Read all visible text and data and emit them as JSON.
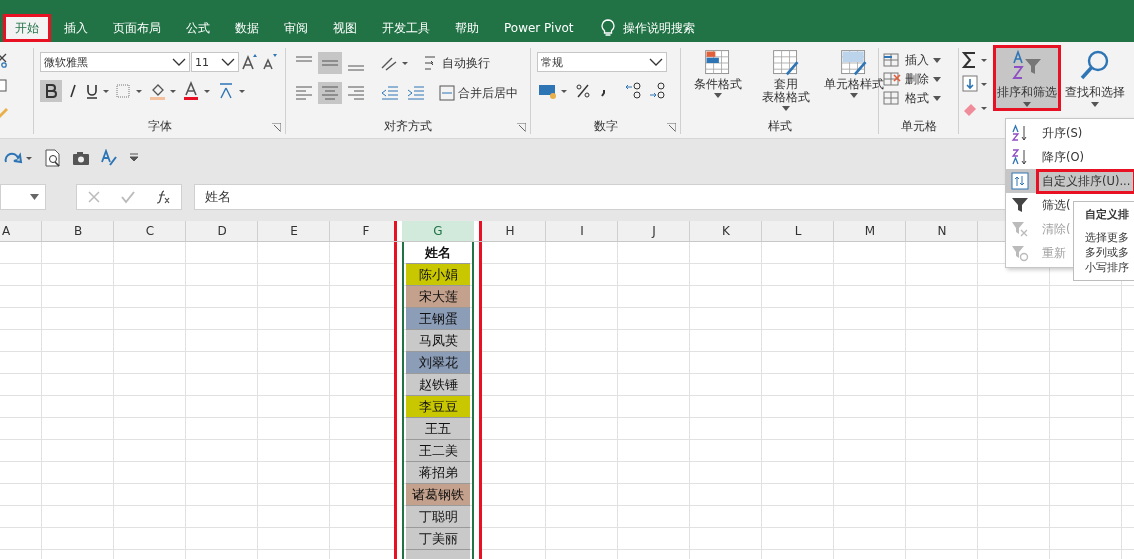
{
  "tabs": [
    {
      "label": "开始",
      "selected": true,
      "highlighted": true
    },
    {
      "label": "插入",
      "selected": false,
      "highlighted": false
    },
    {
      "label": "页面布局",
      "selected": false,
      "highlighted": false
    },
    {
      "label": "公式",
      "selected": false,
      "highlighted": false
    },
    {
      "label": "数据",
      "selected": false,
      "highlighted": false
    },
    {
      "label": "审阅",
      "selected": false,
      "highlighted": false
    },
    {
      "label": "视图",
      "selected": false,
      "highlighted": false
    },
    {
      "label": "开发工具",
      "selected": false,
      "highlighted": false
    },
    {
      "label": "帮助",
      "selected": false,
      "highlighted": false
    },
    {
      "label": "Power Pivot",
      "selected": false,
      "highlighted": false
    }
  ],
  "tell_me": "操作说明搜索",
  "ribbon": {
    "font": {
      "name": "微软雅黑",
      "size": "11",
      "label": "字体"
    },
    "alignment": {
      "wrap": "自动换行",
      "merge": "合并后居中",
      "label": "对齐方式"
    },
    "number": {
      "format": "常规",
      "label": "数字"
    },
    "styles": {
      "buttons": [
        {
          "lines": [
            "条件格式"
          ]
        },
        {
          "lines": [
            "套用",
            "表格格式"
          ]
        },
        {
          "lines": [
            "单元格样式"
          ]
        }
      ],
      "label": "样式"
    },
    "cells": {
      "buttons": [
        "插入",
        "删除",
        "格式"
      ],
      "label": "单元格"
    },
    "editing": {
      "buttons": [
        {
          "label": "排序和筛选",
          "kind": "sort",
          "highlighted": true
        },
        {
          "label": "查找和选择",
          "kind": "find",
          "highlighted": false
        }
      ]
    }
  },
  "formula_bar": {
    "value": "姓名"
  },
  "columns": [
    {
      "label": "A",
      "selected": false,
      "highlighted": false
    },
    {
      "label": "B",
      "selected": false,
      "highlighted": false
    },
    {
      "label": "C",
      "selected": false,
      "highlighted": false
    },
    {
      "label": "D",
      "selected": false,
      "highlighted": false
    },
    {
      "label": "E",
      "selected": false,
      "highlighted": false
    },
    {
      "label": "F",
      "selected": false,
      "highlighted": false
    },
    {
      "label": "G",
      "selected": true,
      "highlighted": true
    },
    {
      "label": "H",
      "selected": false,
      "highlighted": false
    },
    {
      "label": "I",
      "selected": false,
      "highlighted": false
    },
    {
      "label": "J",
      "selected": false,
      "highlighted": false
    },
    {
      "label": "K",
      "selected": false,
      "highlighted": false
    },
    {
      "label": "L",
      "selected": false,
      "highlighted": false
    },
    {
      "label": "M",
      "selected": false,
      "highlighted": false
    },
    {
      "label": "N",
      "selected": false,
      "highlighted": false
    }
  ],
  "cells_g": [
    {
      "text": "姓名",
      "kind": "header"
    },
    {
      "text": "陈小娟",
      "kind": "name",
      "color": "#c9c800"
    },
    {
      "text": "宋大莲",
      "kind": "name",
      "color": "#c4a18c"
    },
    {
      "text": "王钢蛋",
      "kind": "name",
      "color": "#8c9db8"
    },
    {
      "text": "马凤英",
      "kind": "name",
      "color": "#c9c9c9"
    },
    {
      "text": "刘翠花",
      "kind": "name",
      "color": "#8c9db8"
    },
    {
      "text": "赵铁锤",
      "kind": "name",
      "color": "#c9c9c9"
    },
    {
      "text": "李豆豆",
      "kind": "name",
      "color": "#c9c800"
    },
    {
      "text": "王五",
      "kind": "name",
      "color": "#c9c9c9"
    },
    {
      "text": "王二美",
      "kind": "name",
      "color": "#c9c9c9"
    },
    {
      "text": "蒋招弟",
      "kind": "name",
      "color": "#c9c9c9"
    },
    {
      "text": "诸葛钢铁",
      "kind": "name",
      "color": "#c4a18c"
    },
    {
      "text": "丁聪明",
      "kind": "name",
      "color": "#c9c9c9"
    },
    {
      "text": "丁美丽",
      "kind": "name",
      "color": "#c9c9c9"
    }
  ],
  "sort_menu": [
    {
      "label": "升序(S)",
      "kind": "asc",
      "selected": false,
      "disabled": false,
      "highlighted": false
    },
    {
      "label": "降序(O)",
      "kind": "desc",
      "selected": false,
      "disabled": false,
      "highlighted": false
    },
    {
      "label": "自定义排序(U)...",
      "kind": "custom",
      "selected": true,
      "disabled": false,
      "highlighted": true
    },
    {
      "label": "筛选(",
      "kind": "filter",
      "selected": false,
      "disabled": false,
      "highlighted": false
    },
    {
      "label": "清除(",
      "kind": "clear",
      "selected": false,
      "disabled": true,
      "highlighted": false
    },
    {
      "label": "重新",
      "kind": "reapply",
      "selected": false,
      "disabled": true,
      "highlighted": false
    }
  ],
  "tooltip": {
    "title": "自定义排",
    "lines": [
      "选择更多",
      "多列或多",
      "小写排序"
    ]
  }
}
